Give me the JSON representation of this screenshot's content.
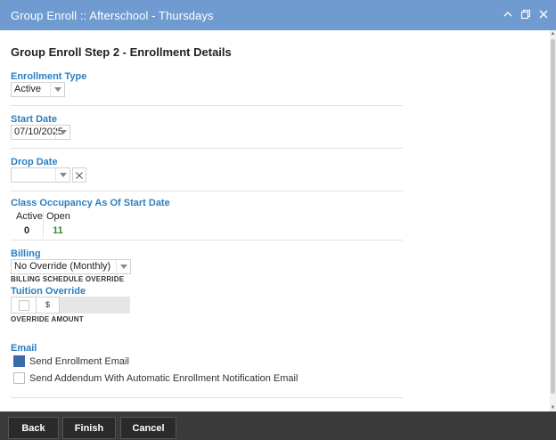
{
  "window": {
    "title": "Group Enroll :: Afterschool - Thursdays"
  },
  "step_title": "Group Enroll Step 2 - Enrollment Details",
  "enrollment_type": {
    "label": "Enrollment Type",
    "value": "Active"
  },
  "start_date": {
    "label": "Start Date",
    "value": "07/10/2025"
  },
  "drop_date": {
    "label": "Drop Date",
    "value": ""
  },
  "occupancy": {
    "label": "Class Occupancy As Of Start Date",
    "active_label": "Active",
    "active_value": "0",
    "open_label": "Open",
    "open_value": "11",
    "open_color": "#2e8b2e"
  },
  "billing": {
    "label": "Billing",
    "value": "No Override (Monthly)",
    "sublabel": "BILLING SCHEDULE OVERRIDE"
  },
  "tuition_override": {
    "label": "Tuition Override",
    "currency": "$",
    "amount": "",
    "sublabel": "OVERRIDE AMOUNT"
  },
  "email": {
    "label": "Email",
    "send_enrollment": {
      "label": "Send Enrollment Email",
      "checked": true
    },
    "send_addendum": {
      "label": "Send Addendum With Automatic Enrollment Notification Email",
      "checked": false
    }
  },
  "footer": {
    "back": "Back",
    "finish": "Finish",
    "cancel": "Cancel"
  },
  "colors": {
    "titlebar": "#6f9bd1",
    "section_label": "#2a7fc1",
    "footer": "#3a3a3a"
  }
}
